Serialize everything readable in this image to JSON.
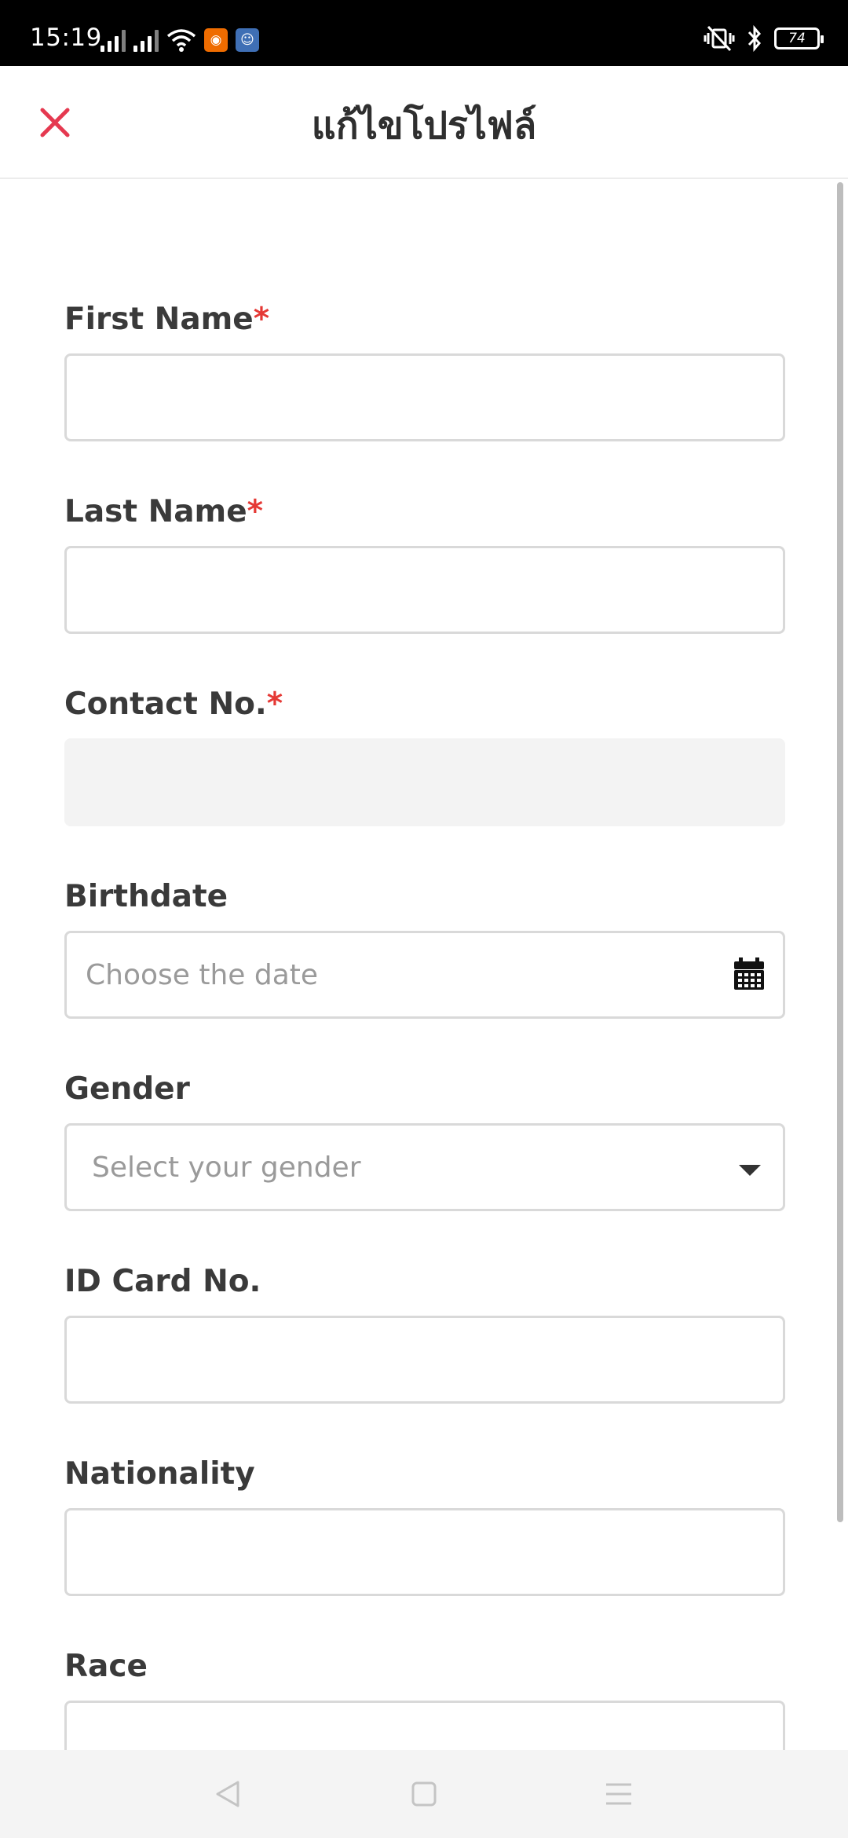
{
  "status_bar": {
    "time": "15:19",
    "battery": "74"
  },
  "header": {
    "title": "แก้ไขโปรไฟล์",
    "close_icon": "close-icon",
    "accent_color": "#e53950"
  },
  "form": {
    "required_marker": "*",
    "fields": {
      "first_name": {
        "label": "First Name",
        "required": true,
        "value": ""
      },
      "last_name": {
        "label": "Last Name",
        "required": true,
        "value": ""
      },
      "contact_no": {
        "label": "Contact No.",
        "required": true,
        "value": "",
        "disabled": true
      },
      "birthdate": {
        "label": "Birthdate",
        "placeholder": "Choose the date",
        "icon": "calendar-icon"
      },
      "gender": {
        "label": "Gender",
        "placeholder": "Select your gender",
        "icon": "chevron-down-icon"
      },
      "id_card_no": {
        "label": "ID Card No.",
        "value": ""
      },
      "nationality": {
        "label": "Nationality",
        "value": ""
      },
      "race": {
        "label": "Race",
        "value": ""
      }
    }
  },
  "nav_bar": {
    "back_icon": "back-triangle-icon",
    "home_icon": "home-square-icon",
    "menu_icon": "menu-lines-icon"
  }
}
